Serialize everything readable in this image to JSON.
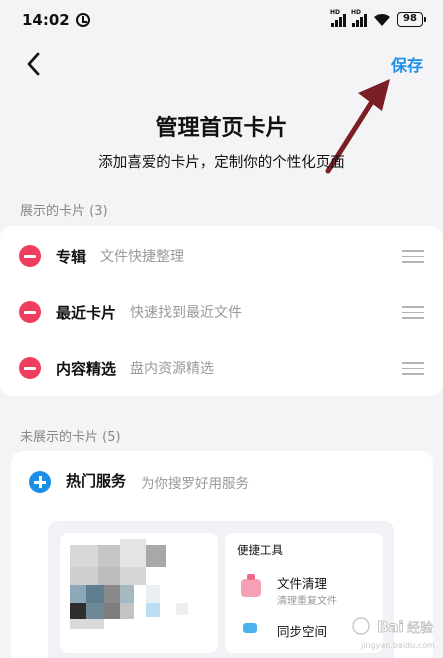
{
  "status": {
    "time": "14:02",
    "battery": "98",
    "signal_label": "HD"
  },
  "nav": {
    "save_label": "保存"
  },
  "header": {
    "title": "管理首页卡片",
    "subtitle": "添加喜爱的卡片，定制你的个性化页面"
  },
  "shown": {
    "title": "展示的卡片 (3)",
    "items": [
      {
        "name": "专辑",
        "desc": "文件快捷整理"
      },
      {
        "name": "最近卡片",
        "desc": "快速找到最近文件"
      },
      {
        "name": "内容精选",
        "desc": "盘内资源精选"
      }
    ]
  },
  "hidden": {
    "title": "未展示的卡片 (5)",
    "items": [
      {
        "name": "热门服务",
        "desc": "为你搜罗好用服务"
      }
    ],
    "preview": {
      "tools_title": "便捷工具",
      "tool1_name": "文件清理",
      "tool1_desc": "清理重复文件",
      "tool2_name": "同步空间"
    }
  },
  "watermark": {
    "text": "Baidu经验",
    "url": "jingyan.baidu.com"
  },
  "colors": {
    "accent": "#1a8fe8",
    "remove": "#f03c5f",
    "annotation_arrow": "#7a1f25"
  }
}
